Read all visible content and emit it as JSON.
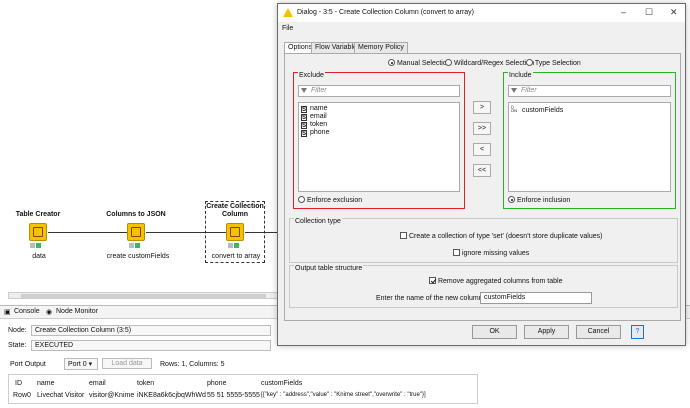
{
  "workflow": {
    "nodes": [
      {
        "title": "Table Creator",
        "label": "data"
      },
      {
        "title": "Columns to JSON",
        "label": "create customFields"
      },
      {
        "title": "Create Collection Column",
        "label": "convert to array"
      }
    ]
  },
  "bottom_panel": {
    "tabs": [
      "Console",
      "Node Monitor"
    ],
    "node_label": "Node:",
    "node_value": "Create Collection Column  (3:5)",
    "state_label": "State:",
    "state_value": "EXECUTED",
    "port_output_label": "Port Output",
    "port_select": "Port 0",
    "load_data_label": "Load data",
    "rows_info": "Rows: 1, Columns: 5",
    "table": {
      "headers": [
        "ID",
        "name",
        "email",
        "token",
        "phone",
        "customFields"
      ],
      "rows": [
        [
          "Row0",
          "Livechat Visitor",
          "visitor@Knime",
          "iNKE8a6k6cjbqWhWd",
          "55 51 5555-5555",
          "[{\"key\" : \"address\",\"value\" : \"Knime street\",\"overwrite\" : \"true\"}]"
        ]
      ]
    }
  },
  "dialog": {
    "title": "Dialog - 3:5 - Create Collection Column (convert to array)",
    "menu_file": "File",
    "tabs": [
      "Options",
      "Flow Variables",
      "Memory Policy"
    ],
    "selection_modes": [
      "Manual Selection",
      "Wildcard/Regex Selection",
      "Type Selection"
    ],
    "exclude": {
      "title": "Exclude",
      "filter_placeholder": "Filter",
      "items": [
        "name",
        "email",
        "token",
        "phone"
      ],
      "enforce_label": "Enforce exclusion"
    },
    "include": {
      "title": "Include",
      "filter_placeholder": "Filter",
      "items": [
        "customFields"
      ],
      "enforce_label": "Enforce inclusion"
    },
    "move_buttons": [
      ">",
      ">>",
      "<",
      "<<"
    ],
    "collection_type": {
      "title": "Collection type",
      "set_label": "Create a collection of type 'set' (doesn't store duplicate values)",
      "ignore_missing_label": "ignore missing values"
    },
    "output": {
      "title": "Output table structure",
      "remove_label": "Remove aggregated columns from table",
      "name_label": "Enter the name of the new column:",
      "name_value": "customFields"
    },
    "buttons": [
      "OK",
      "Apply",
      "Cancel",
      "?"
    ],
    "colors": {
      "exclude_border": "#e02020",
      "include_border": "#22b922"
    }
  }
}
